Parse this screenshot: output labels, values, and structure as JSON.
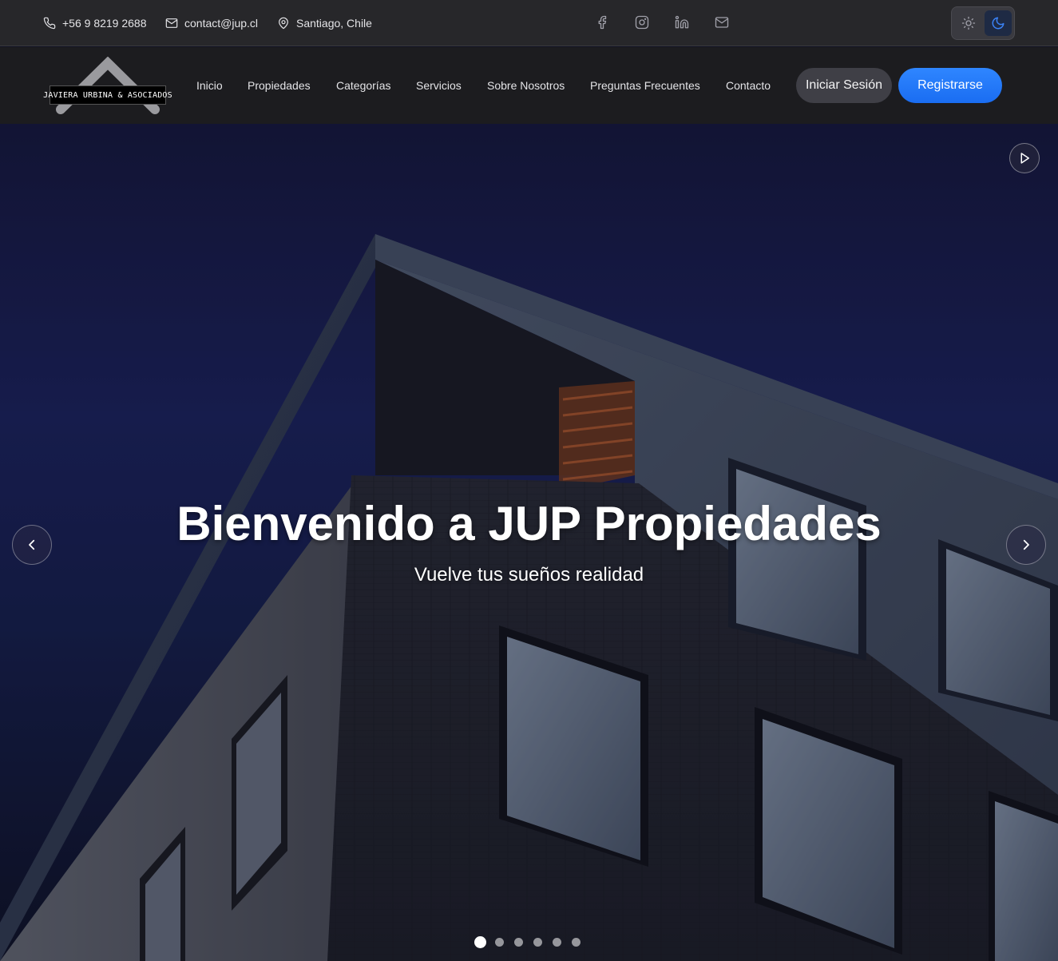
{
  "topbar": {
    "phone": "+56 9 8219 2688",
    "email": "contact@jup.cl",
    "location": "Santiago, Chile",
    "social_icons": [
      "facebook-icon",
      "instagram-icon",
      "linkedin-icon",
      "mail-icon"
    ],
    "theme_toggle": {
      "options": [
        "light",
        "dark"
      ],
      "selected": "dark"
    }
  },
  "navbar": {
    "logo_text": "JAVIERA URBINA & ASOCIADOS",
    "links": [
      "Inicio",
      "Propiedades",
      "Categorías",
      "Servicios",
      "Sobre Nosotros",
      "Preguntas Frecuentes",
      "Contacto"
    ],
    "login_label": "Iniciar Sesión",
    "register_label": "Registrarse"
  },
  "hero": {
    "title": "Bienvenido a JUP Propiedades",
    "subtitle": "Vuelve tus sueños realidad",
    "slide_count": 6,
    "active_slide": 1
  },
  "colors": {
    "topbar_bg": "#27272a",
    "navbar_bg": "#1c1c1f",
    "accent": "#2f86ff",
    "login_bg": "#3f3f46"
  }
}
